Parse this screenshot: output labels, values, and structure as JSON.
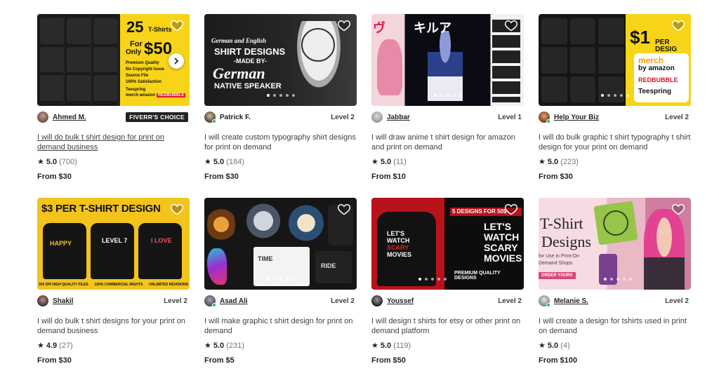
{
  "gigs": [
    {
      "seller": "Ahmed M.",
      "level": "",
      "badge": "FIVERR'S CHOICE",
      "title": "I will do bulk t shirt design for print on demand business",
      "rating": "5.0",
      "reviews": "(700)",
      "price": "From $30",
      "thumb_text": [
        "25",
        "T-Shirts",
        "For",
        "Only",
        "$50"
      ],
      "thumb_features": [
        "Premium Quality",
        "No Copyright Issue",
        "Source File",
        "100% Satisfaction"
      ],
      "thumb_logos": [
        "Teespring",
        "merch",
        "amazon",
        "REDBUBBLE"
      ],
      "colors": {
        "bg": "#111111",
        "accent": "#f7d417"
      }
    },
    {
      "seller": "Patrick F.",
      "level": "Level 2",
      "badge": "",
      "title": "I will create custom typography shirt designs for print on demand",
      "rating": "5.0",
      "reviews": "(184)",
      "price": "From $30",
      "thumb_text": [
        "German and English",
        "SHIRT DESIGNS",
        "-MADE BY-",
        "German",
        "NATIVE SPEAKER"
      ],
      "colors": {
        "bg": "#1b1b1b",
        "accent": "#ffffff"
      }
    },
    {
      "seller": "Jabbar",
      "level": "Level 1",
      "badge": "",
      "title": "I will draw anime t shirt design for amazon and print on demand",
      "rating": "5.0",
      "reviews": "(11)",
      "price": "From $10",
      "colors": {
        "bg": "#0b0b14",
        "accent": "#e0417b"
      }
    },
    {
      "seller": "Help Your Biz",
      "level": "Level 2",
      "badge": "",
      "title": "I will do bulk graphic t shirt typography t shirt design for your print on demand",
      "rating": "5.0",
      "reviews": "(223)",
      "price": "From $30",
      "thumb_text": [
        "$1",
        "PER DESIG",
        "merch",
        "by amazon",
        "REDBUBBLE",
        "Teespring"
      ],
      "colors": {
        "bg": "#151515",
        "accent": "#f7d417"
      }
    },
    {
      "seller": "Shakil",
      "level": "Level 2",
      "badge": "",
      "title": "I will do bulk t shirt designs for your print on demand business",
      "rating": "4.9",
      "reviews": "(27)",
      "price": "From $30",
      "thumb_text": [
        "$3 PER T-SHIRT DESIGN",
        "300 DPI HIGH QUALITY FILES",
        "100% COMMERCIAL RIGHTS",
        "UNLIMITED REVISIONS"
      ],
      "colors": {
        "bg": "#f2c41c",
        "accent": "#111111"
      }
    },
    {
      "seller": "Asad Ali",
      "level": "Level 2",
      "badge": "",
      "title": "I will make graphic t shirt design for print on demand",
      "rating": "5.0",
      "reviews": "(231)",
      "price": "From $5",
      "colors": {
        "bg": "#161616",
        "accent": "#e9a23b"
      }
    },
    {
      "seller": "Youssef",
      "level": "Level 2",
      "badge": "",
      "title": "I will design t shirts for etsy or other print on demand platform",
      "rating": "5.0",
      "reviews": "(119)",
      "price": "From $50",
      "thumb_text": [
        "5 DESIGNS FOR 50$",
        "LET'S WATCH SCARY MOVIES",
        "PREMIUM QUALITY DESIGNS"
      ],
      "colors": {
        "bg": "#b8121b",
        "accent": "#ffffff"
      }
    },
    {
      "seller": "Melanie S.",
      "level": "Level 2",
      "badge": "",
      "title": "I will create a design for tshirts used in print on demand",
      "rating": "5.0",
      "reviews": "(4)",
      "price": "From $100",
      "thumb_text": [
        "T-Shirt",
        "Designs",
        "for Use in Print-On",
        "Demand Shops",
        "ORDER YOURS"
      ],
      "colors": {
        "bg": "#f4c9d6",
        "accent": "#222222"
      }
    }
  ]
}
